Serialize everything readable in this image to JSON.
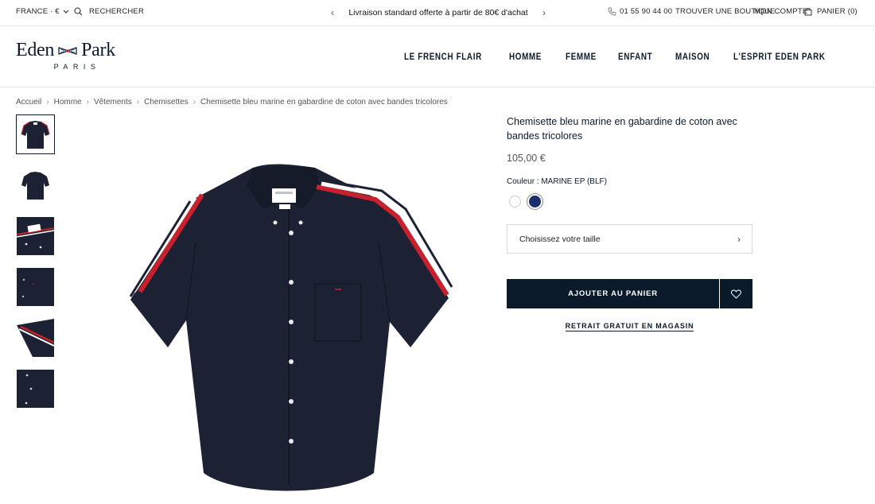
{
  "topbar": {
    "region": "FRANCE · €",
    "search": "RECHERCHER",
    "promo": "Livraison standard offerte à partir de 80€ d'achat",
    "phone": "01 55 90 44 00",
    "store": "TROUVER UNE BOUTIQUE",
    "account": "MON COMPTE",
    "cart": "PANIER (0)"
  },
  "brand": {
    "name_left": "Eden",
    "name_right": "Park",
    "tagline": "PARIS"
  },
  "nav": [
    "LE FRENCH FLAIR",
    "HOMME",
    "FEMME",
    "ENFANT",
    "MAISON",
    "L'ESPRIT EDEN PARK"
  ],
  "breadcrumb": [
    "Accueil",
    "Homme",
    "Vêtements",
    "Chemisettes",
    "Chemisette bleu marine en gabardine de coton avec bandes tricolores"
  ],
  "product": {
    "title": "Chemisette bleu marine en gabardine de coton avec bandes tricolores",
    "price": "105,00 €",
    "color_label": "Couleur : MARINE EP (BLF)",
    "size_placeholder": "Choisissez votre taille",
    "add_to_cart": "AJOUTER AU PANIER",
    "pickup": "RETRAIT GRATUIT EN MAGASIN",
    "colors": [
      "#ffffff",
      "#1a2f6b"
    ]
  },
  "colors": {
    "navy": "#0b1a2b",
    "shirt": "#1c2233",
    "red": "#c8202c"
  }
}
